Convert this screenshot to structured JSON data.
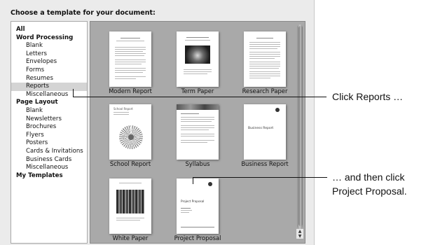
{
  "dialog": {
    "heading": "Choose a template for your document:"
  },
  "sidebar": {
    "items": [
      {
        "label": "All",
        "kind": "cat"
      },
      {
        "label": "Word Processing",
        "kind": "cat"
      },
      {
        "label": "Blank",
        "kind": "sub"
      },
      {
        "label": "Letters",
        "kind": "sub"
      },
      {
        "label": "Envelopes",
        "kind": "sub"
      },
      {
        "label": "Forms",
        "kind": "sub"
      },
      {
        "label": "Resumes",
        "kind": "sub"
      },
      {
        "label": "Reports",
        "kind": "sub",
        "selected": true
      },
      {
        "label": "Miscellaneous",
        "kind": "sub"
      },
      {
        "label": "Page Layout",
        "kind": "cat"
      },
      {
        "label": "Blank",
        "kind": "sub"
      },
      {
        "label": "Newsletters",
        "kind": "sub"
      },
      {
        "label": "Brochures",
        "kind": "sub"
      },
      {
        "label": "Flyers",
        "kind": "sub"
      },
      {
        "label": "Posters",
        "kind": "sub"
      },
      {
        "label": "Cards & Invitations",
        "kind": "sub"
      },
      {
        "label": "Business Cards",
        "kind": "sub"
      },
      {
        "label": "Miscellaneous",
        "kind": "sub"
      },
      {
        "label": "My Templates",
        "kind": "cat"
      }
    ]
  },
  "templates": [
    {
      "label": "Modern Report"
    },
    {
      "label": "Term Paper"
    },
    {
      "label": "Research Paper"
    },
    {
      "label": "School Report",
      "thumb_title": "School Report"
    },
    {
      "label": "Syllabus"
    },
    {
      "label": "Business Report",
      "thumb_title": "Business Report"
    },
    {
      "label": "White Paper"
    },
    {
      "label": "Project Proposal",
      "thumb_title": "Project Proposal"
    }
  ],
  "callouts": {
    "first": "Click Reports …",
    "second_line1": "… and then click",
    "second_line2": "Project Proposal."
  },
  "scrollbar": {
    "up_glyph": "▲",
    "down_glyph": "▼"
  }
}
